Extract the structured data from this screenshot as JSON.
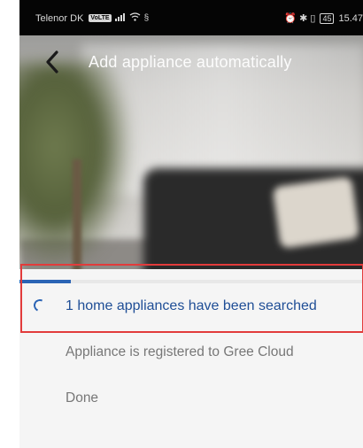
{
  "status_bar": {
    "carrier": "Telenor DK",
    "volte": "VoLTE",
    "right_icons": "⏰ ✱ ▯",
    "battery": "45",
    "time": "15.47"
  },
  "header": {
    "title": "Add appliance automatically"
  },
  "progress": {
    "fraction": 0.15
  },
  "steps": [
    {
      "label": "1 home appliances have been searched",
      "state": "active"
    },
    {
      "label": "Appliance is registered to Gree Cloud",
      "state": "pending"
    },
    {
      "label": "Done",
      "state": "pending"
    }
  ],
  "colors": {
    "accent": "#2b64b5",
    "active_text": "#1f4e96",
    "inactive_text": "#777777",
    "highlight": "#e23b3b"
  }
}
